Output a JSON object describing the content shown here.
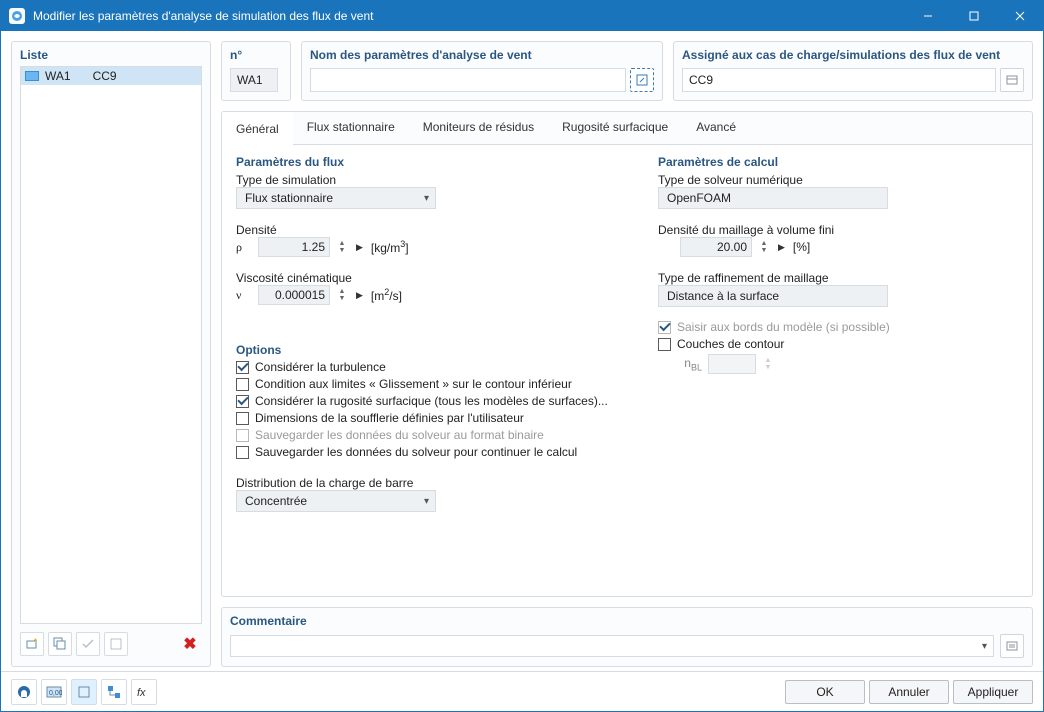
{
  "window": {
    "title": "Modifier les paramètres d'analyse de simulation des flux de vent"
  },
  "left": {
    "list_header": "Liste",
    "items": [
      {
        "a": "WA1",
        "b": "CC9"
      }
    ]
  },
  "fields": {
    "num_label": "n°",
    "num_value": "WA1",
    "name_label": "Nom des paramètres d'analyse de vent",
    "name_value": "",
    "assign_label": "Assigné aux cas de charge/simulations des flux de vent",
    "assign_value": "CC9"
  },
  "tabs": {
    "general": "Général",
    "steady": "Flux stationnaire",
    "residual": "Moniteurs de résidus",
    "roughness": "Rugosité surfacique",
    "advanced": "Avancé"
  },
  "flow": {
    "title": "Paramètres du flux",
    "sim_type_label": "Type de simulation",
    "sim_type_value": "Flux stationnaire",
    "density_label": "Densité",
    "density_symbol": "ρ",
    "density_value": "1.25",
    "density_unit": "[kg/m",
    "density_unit_sup": "3",
    "density_unit_end": "]",
    "viscosity_label": "Viscosité cinématique",
    "viscosity_symbol": "ν",
    "viscosity_value": "0.000015",
    "viscosity_unit": "[m",
    "viscosity_unit_sup": "2",
    "viscosity_unit_end": "/s]"
  },
  "options": {
    "title": "Options",
    "turbulence": "Considérer la turbulence",
    "slip": "Condition aux limites « Glissement » sur le contour inférieur",
    "roughness": "Considérer la rugosité surfacique (tous les modèles de surfaces)...",
    "dims": "Dimensions de la soufflerie définies par l'utilisateur",
    "save_binary": "Sauvegarder les données du solveur au format binaire",
    "save_continue": "Sauvegarder les données du solveur pour continuer le calcul",
    "dist_label": "Distribution de la charge de barre",
    "dist_value": "Concentrée"
  },
  "calc": {
    "title": "Paramètres de calcul",
    "solver_label": "Type de solveur numérique",
    "solver_value": "OpenFOAM",
    "mesh_density_label": "Densité du maillage à volume fini",
    "mesh_density_value": "20.00",
    "mesh_density_unit": "[%]",
    "refine_label": "Type de raffinement de maillage",
    "refine_value": "Distance à la surface",
    "snap": "Saisir aux bords du modèle (si possible)",
    "layers": "Couches de contour",
    "nbl_label": "n",
    "nbl_sub": "BL",
    "nbl_value": ""
  },
  "comment": {
    "title": "Commentaire",
    "value": ""
  },
  "footer": {
    "ok": "OK",
    "cancel": "Annuler",
    "apply": "Appliquer"
  }
}
